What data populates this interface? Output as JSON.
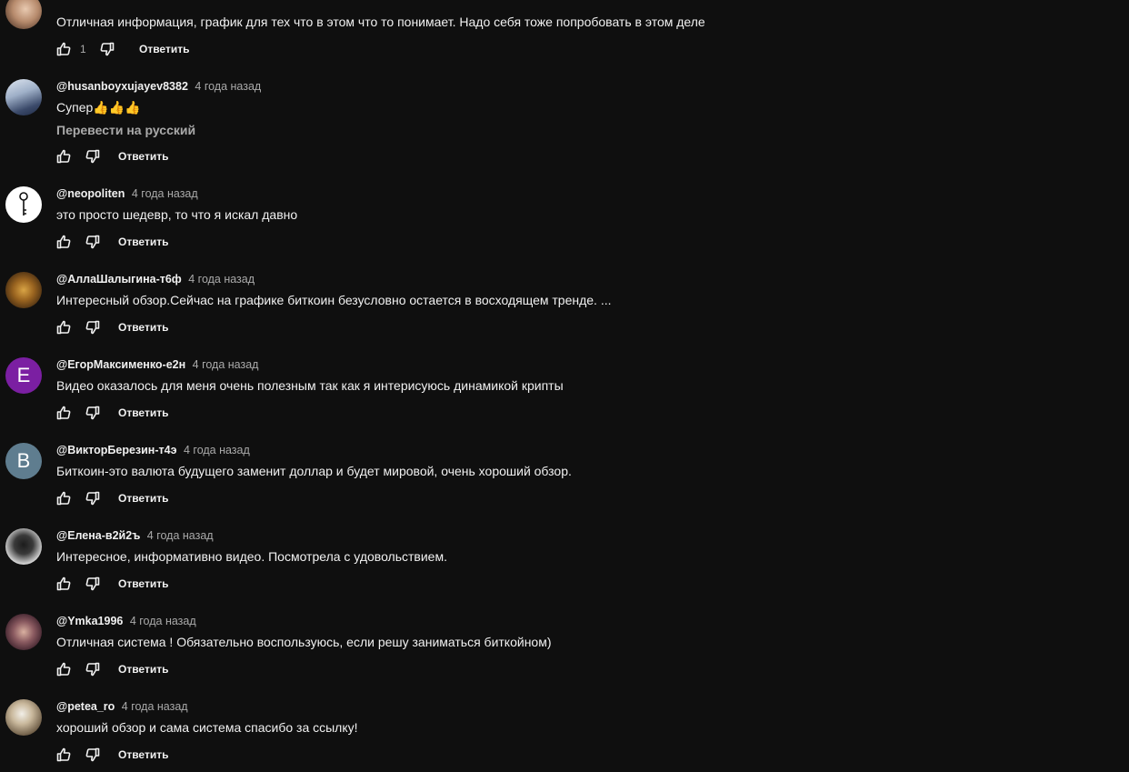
{
  "comments": [
    {
      "author": "",
      "time": "",
      "text": "Отличная информация,  график для тех что в этом что то понимает. Надо себя тоже попробовать в этом деле",
      "likes": "1",
      "reply_label": "Ответить",
      "avatar_color": "#c9a48a"
    },
    {
      "author": "@husanboyxujayev8382",
      "time": "4 года назад",
      "text": "Супер👍👍👍",
      "translate_label": "Перевести на русский",
      "reply_label": "Ответить",
      "avatar_color": "#7b8ba8"
    },
    {
      "author": "@neopoliten",
      "time": "4 года назад",
      "text": "это просто шедевр, то что я искал давно",
      "reply_label": "Ответить",
      "avatar_color": "#ffffff"
    },
    {
      "author": "@АллаШалыгина-т6ф",
      "time": "4 года назад",
      "text": "Интересный обзор.Сейчас на  графике биткоин безусловно остается в восходящем тренде. ...",
      "reply_label": "Ответить",
      "avatar_color": "#6b4a1e"
    },
    {
      "author": "@ЕгорМаксименко-е2н",
      "time": "4 года назад",
      "text": "Видео оказалось для меня очень полезным так как я интерисуюсь динамикой крипты",
      "reply_label": "Ответить",
      "avatar_letter": "Е",
      "avatar_color": "#7b1fa2"
    },
    {
      "author": "@ВикторБерезин-т4э",
      "time": "4 года назад",
      "text": "Биткоин-это валюта будущего заменит доллар и будет мировой, очень хороший обзор.",
      "reply_label": "Ответить",
      "avatar_letter": "В",
      "avatar_color": "#5f7d8f"
    },
    {
      "author": "@Елена-в2й2ъ",
      "time": "4 года назад",
      "text": "Интересное, информативно видео. Посмотрела с удовольствием.",
      "reply_label": "Ответить",
      "avatar_color": "#d8d8d8"
    },
    {
      "author": "@Ymka1996",
      "time": "4 года назад",
      "text": "Отличная система ! Обязательно воспользуюсь, если решу заниматься биткойном)",
      "reply_label": "Ответить",
      "avatar_color": "#5a3a46"
    },
    {
      "author": "@petea_ro",
      "time": "4 года назад",
      "text": "хороший обзор и сама система спасибо за ссылку!",
      "reply_label": "Ответить",
      "avatar_color": "#b6a68e"
    }
  ]
}
